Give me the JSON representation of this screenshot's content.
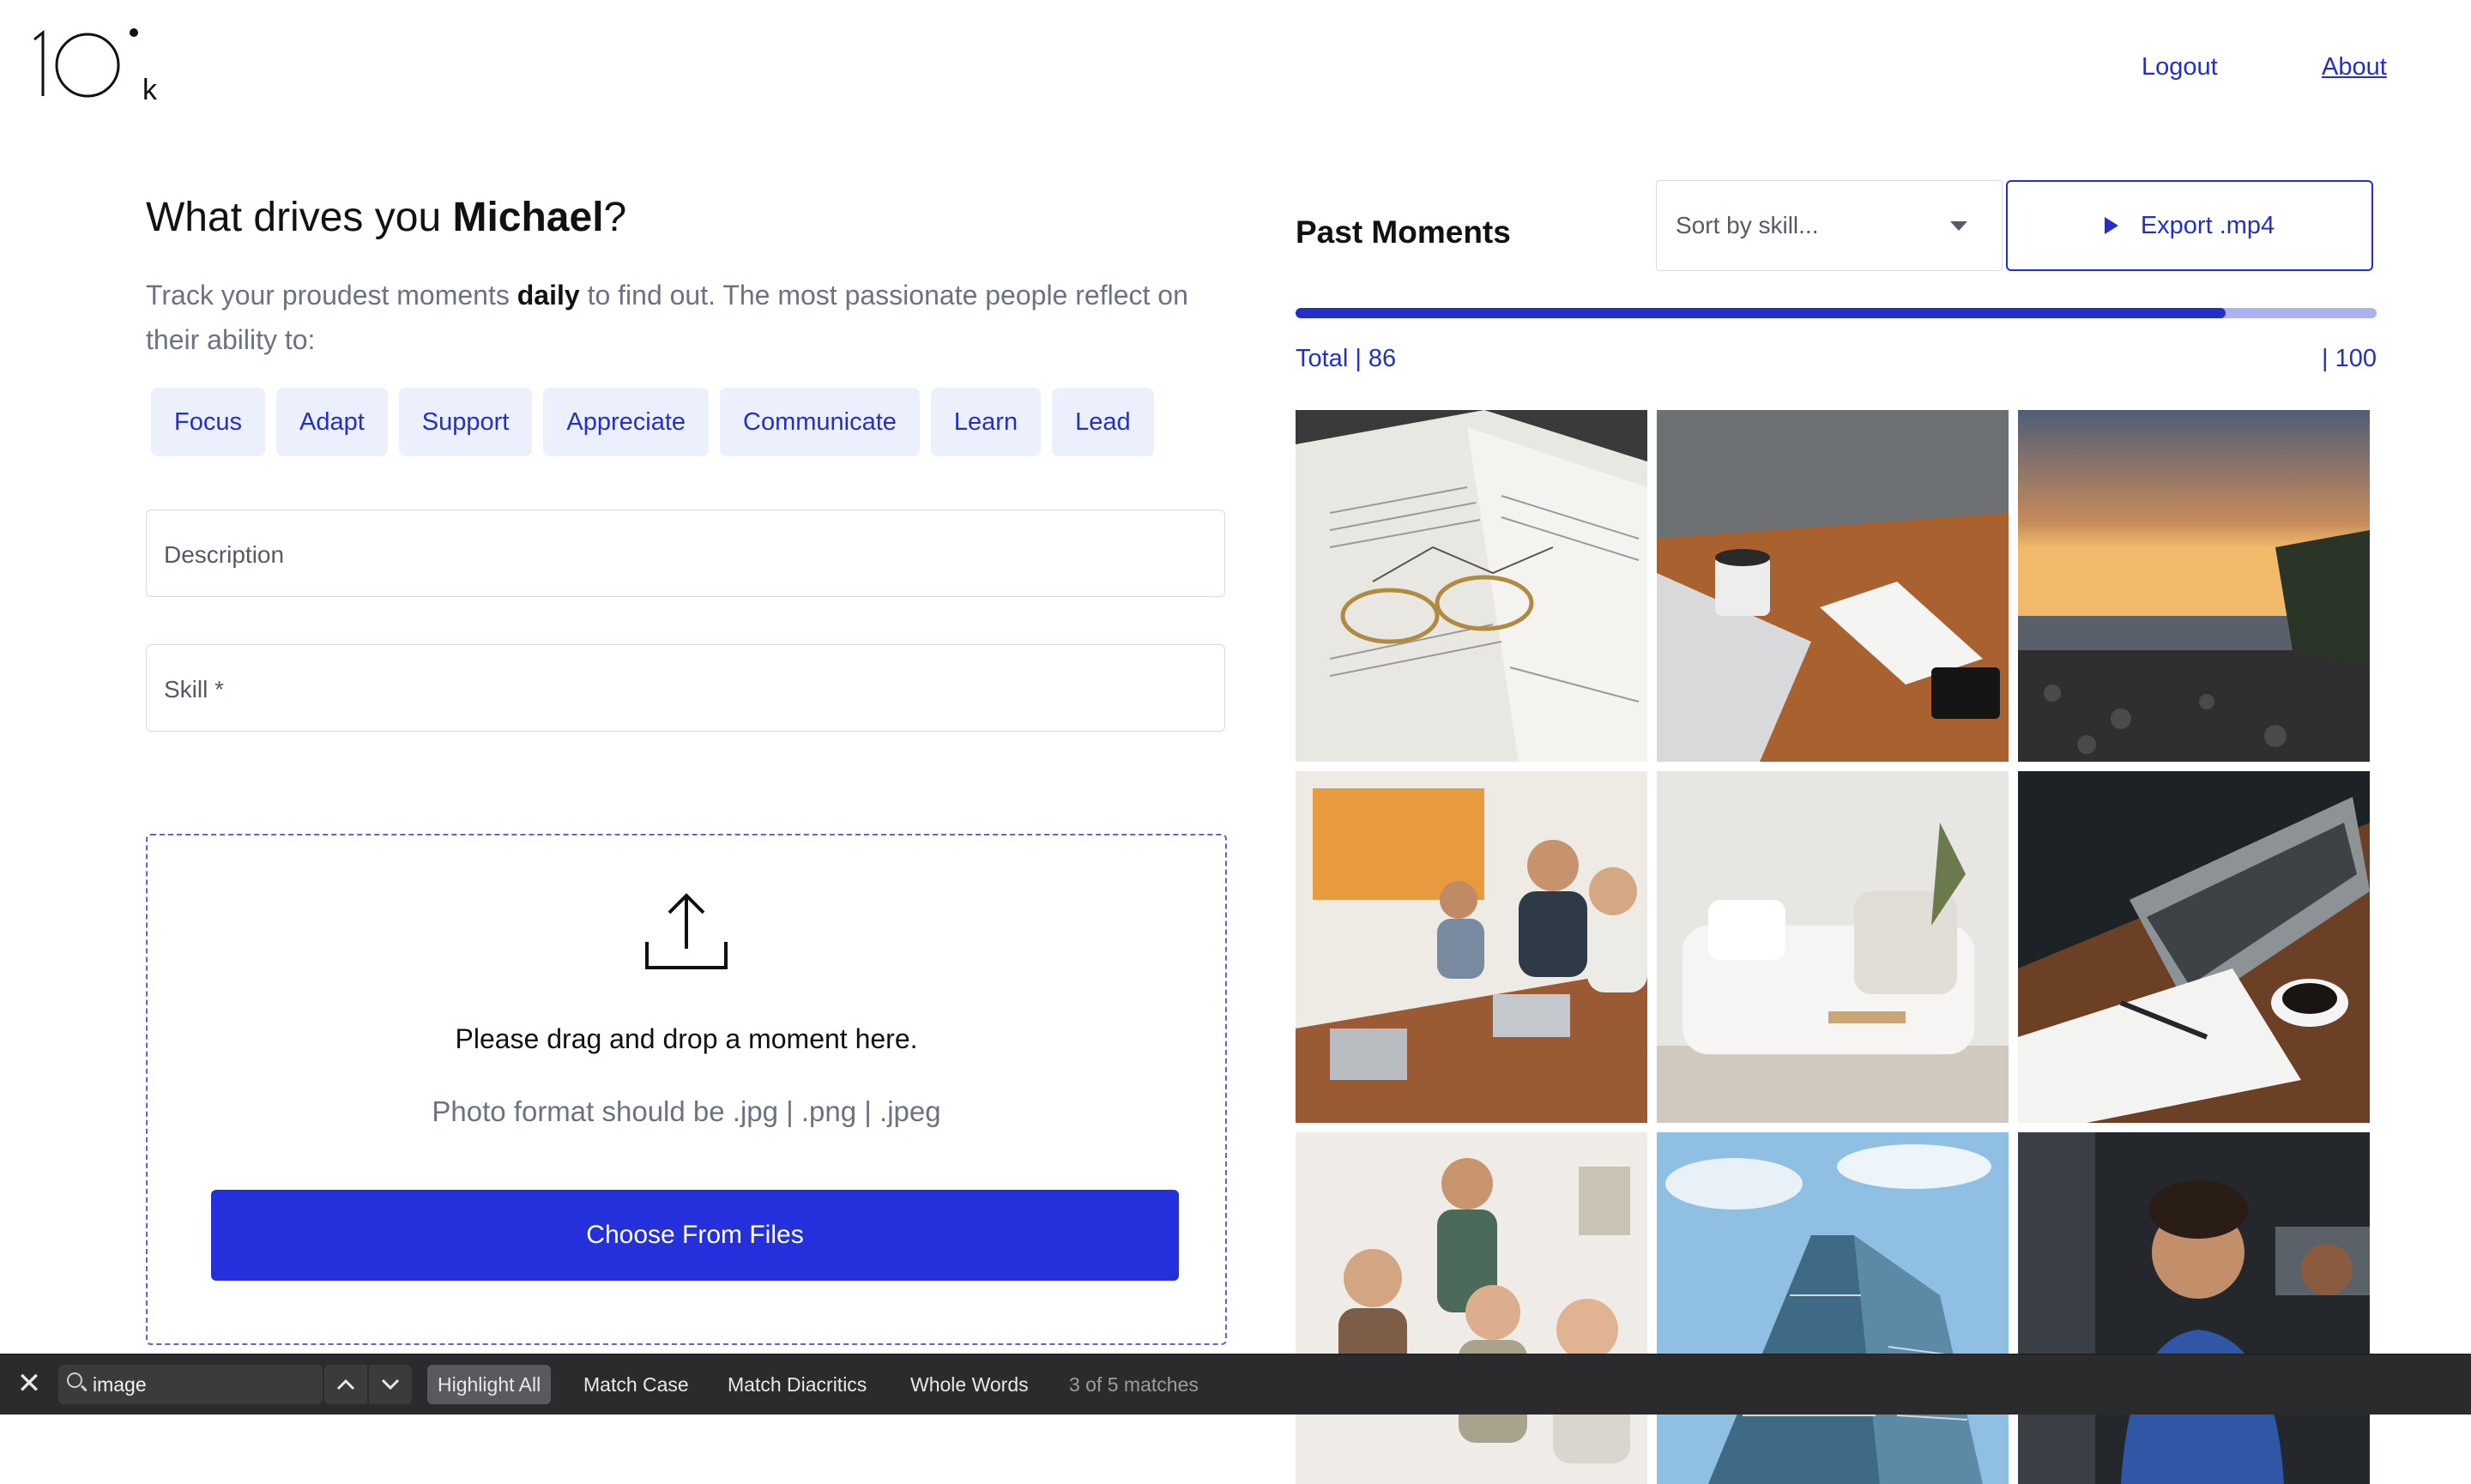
{
  "header": {
    "logo_text": "10k",
    "logout_label": "Logout",
    "about_label": "About"
  },
  "intro": {
    "greeting_prefix": "What drives you ",
    "user_name": "Michael",
    "greeting_suffix": "?",
    "subtext_prefix": "Track your proudest moments ",
    "subtext_bold": "daily",
    "subtext_suffix": " to find out. The most passionate people reflect on their ability to:"
  },
  "skills": [
    "Focus",
    "Adapt",
    "Support",
    "Appreciate",
    "Communicate",
    "Learn",
    "Lead"
  ],
  "form": {
    "description_placeholder": "Description",
    "skill_placeholder": "Skill *"
  },
  "upload": {
    "title": "Please drag and drop a moment here.",
    "formats": "Photo format should be .jpg | .png | .jpeg",
    "button_label": "Choose From Files"
  },
  "past_moments": {
    "title": "Past Moments",
    "sort_placeholder": "Sort by skill...",
    "export_label": "Export .mp4",
    "total_label": "Total | 86",
    "max_label": "| 100",
    "progress_fraction": 0.86,
    "photos": [
      "open-book-with-glasses",
      "laptop-coffee-notepad-desk",
      "sunset-rocky-beach",
      "team-meeting-laptops",
      "white-sofa-living-room",
      "laptop-notebook-coffee-desk",
      "group-of-smiling-students",
      "glass-skyscraper",
      "smiling-woman-office"
    ]
  },
  "findbar": {
    "query": "image",
    "highlight_all": "Highlight All",
    "match_case": "Match Case",
    "match_diacritics": "Match Diacritics",
    "whole_words": "Whole Words",
    "status": "3 of 5 matches"
  },
  "colors": {
    "accent": "#2230c9",
    "button": "#2330dc",
    "chip_bg": "#eceffc",
    "progress_track": "#aab2f4",
    "muted_text": "#6b7282"
  }
}
